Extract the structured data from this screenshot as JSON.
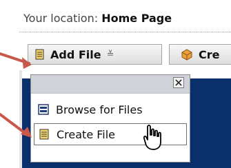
{
  "location": {
    "label": "Your location:",
    "value": "Home Page"
  },
  "toolbar": {
    "add_file_label": "Add File",
    "create_label": "Cre"
  },
  "dropdown": {
    "items": [
      {
        "label": "Browse for Files",
        "icon": "browse-files-icon"
      },
      {
        "label": "Create File",
        "icon": "document-icon"
      }
    ]
  },
  "colors": {
    "accent_arrow": "#c7584a",
    "content_bg": "#0b2f6b",
    "dropdown_header": "#cfd3d8"
  }
}
